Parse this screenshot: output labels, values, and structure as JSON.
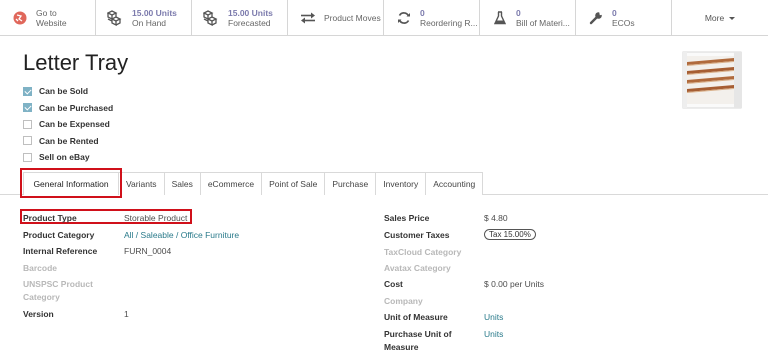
{
  "smart_buttons": [
    {
      "icon": "globe-icon",
      "line1": "Go to",
      "line2": "Website"
    },
    {
      "icon": "cubes-icon",
      "line1": "15.00 Units",
      "line2": "On Hand"
    },
    {
      "icon": "cubes-icon",
      "line1": "15.00 Units",
      "line2": "Forecasted"
    },
    {
      "icon": "exchange-arrows-icon",
      "label": "Product Moves"
    },
    {
      "icon": "refresh-icon",
      "line1": "0",
      "line2": "Reordering R..."
    },
    {
      "icon": "flask-icon",
      "line1": "0",
      "line2": "Bill of Materi..."
    },
    {
      "icon": "wrench-icon",
      "line1": "0",
      "line2": "ECOs"
    },
    {
      "label": "More"
    }
  ],
  "colors": {
    "accent": "#7c7bad",
    "link": "#297a8a",
    "highlight": "#d0101a",
    "checkbox_on": "#7fb2c5"
  },
  "product": {
    "name": "Letter Tray",
    "flags": [
      {
        "label": "Can be Sold",
        "checked": true
      },
      {
        "label": "Can be Purchased",
        "checked": true
      },
      {
        "label": "Can be Expensed",
        "checked": false
      },
      {
        "label": "Can be Rented",
        "checked": false
      },
      {
        "label": "Sell on eBay",
        "checked": false
      }
    ]
  },
  "tabs": [
    "General Information",
    "Variants",
    "Sales",
    "eCommerce",
    "Point of Sale",
    "Purchase",
    "Inventory",
    "Accounting"
  ],
  "left_fields": [
    {
      "label": "Product Type",
      "value": "Storable Product"
    },
    {
      "label": "Product Category",
      "value": "All / Saleable / Office Furniture"
    },
    {
      "label": "Internal Reference",
      "value": "FURN_0004"
    },
    {
      "label": "Barcode",
      "value": ""
    },
    {
      "label": "UNSPSC Product",
      "label2": "Category",
      "value": ""
    },
    {
      "label": "Version",
      "value": "1"
    }
  ],
  "right_fields": [
    {
      "label": "Sales Price",
      "value": "$ 4.80"
    },
    {
      "label": "Customer Taxes",
      "value": "Tax 15.00%"
    },
    {
      "label": "TaxCloud Category",
      "value": ""
    },
    {
      "label": "Avatax Category",
      "value": ""
    },
    {
      "label": "Cost",
      "value": "$ 0.00",
      "unit": "per Units"
    },
    {
      "label": "Company",
      "value": ""
    },
    {
      "label": "Unit of Measure",
      "value": "Units"
    },
    {
      "label": "Purchase Unit of",
      "label2": "Measure",
      "value": "Units"
    }
  ]
}
